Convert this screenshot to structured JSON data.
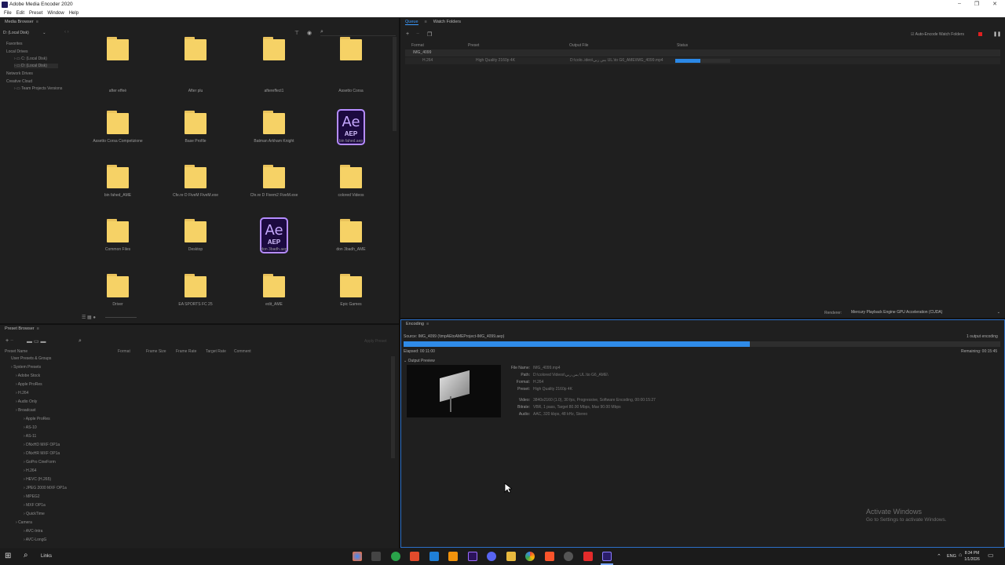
{
  "app": {
    "title": "Adobe Media Encoder 2020",
    "min": "–",
    "max": "❐",
    "close": "✕"
  },
  "menu": [
    "File",
    "Edit",
    "Preset",
    "Window",
    "Help"
  ],
  "media_browser": {
    "title": "Media Browser",
    "drive": "D: (Local Disk)",
    "tree": [
      "Favorites",
      "Local Drives",
      "C: (Local Disk)",
      "D: (Local Disk)",
      "Network Drives",
      "Creative Cloud",
      "Team Projects Versions"
    ],
    "items": [
      {
        "label": "after effeè",
        "type": "folder"
      },
      {
        "label": "After plu",
        "type": "folder"
      },
      {
        "label": "aftereffect1",
        "type": "folder"
      },
      {
        "label": "Assetto Corsa",
        "type": "folder"
      },
      {
        "label": "Assetto Corsa Competizione",
        "type": "folder"
      },
      {
        "label": "Base Profile",
        "type": "folder"
      },
      {
        "label": "Batman  Arkham Knight",
        "type": "folder"
      },
      {
        "label": "bin fahed.aep",
        "type": "aep"
      },
      {
        "label": "bin fahed_AME",
        "type": "folder"
      },
      {
        "label": "Cfe.re  D  FiveM FiveM.exe",
        "type": "folder"
      },
      {
        "label": "Cfe.re  D  Fivem2 FiveM.exe",
        "type": "folder"
      },
      {
        "label": "colored Videos",
        "type": "folder"
      },
      {
        "label": "Common Files",
        "type": "folder"
      },
      {
        "label": "Desktop",
        "type": "folder"
      },
      {
        "label": "don 3badh.aep",
        "type": "aep"
      },
      {
        "label": "don 3badh_AME",
        "type": "folder"
      },
      {
        "label": "Driver",
        "type": "folder"
      },
      {
        "label": "EA SPORTS FC 25",
        "type": "folder"
      },
      {
        "label": "edit_AME",
        "type": "folder"
      },
      {
        "label": "Epic Games",
        "type": "folder"
      }
    ],
    "aep_big": "Ae",
    "aep_small": "AEP"
  },
  "queue": {
    "tabs": [
      "Queue",
      "Watch Folders"
    ],
    "columns": {
      "format": "Format",
      "preset": "Preset",
      "output": "Output File",
      "status": "Status"
    },
    "auto_encode": "Auto-Encode Watch Folders",
    "row": {
      "name": "IMG_4099",
      "format": "H.264",
      "preset": "High Quality 2160p 4K",
      "output": "D:\\colo..ideo\\بس ربي UL.\\to G6_AME\\IMG_4099.mp4",
      "progress": 0.45
    },
    "renderer_label": "Renderer:",
    "renderer": "Mercury Playback Engine GPU Acceleration (CUDA)"
  },
  "encoding": {
    "title": "Encoding",
    "source": "Source: IMG_4099 (\\tmpAEtoAMEProject-IMG_4099.aep)",
    "outputs": "1 output encoding",
    "elapsed": "Elapsed: 00:11:00",
    "remaining": "Remaining: 00:15:45",
    "progress": 0.58,
    "output_preview": "Output Preview",
    "details": [
      {
        "k": "File Name:",
        "v": "IMG_4099.mp4"
      },
      {
        "k": "Path:",
        "v": "D:\\colored Videos\\بس ربي UL.\\to G6_AME\\"
      },
      {
        "k": "Format:",
        "v": "H.264"
      },
      {
        "k": "Preset:",
        "v": "High Quality 2160p 4K"
      },
      {
        "k": "Video:",
        "v": "3840x2160 (1.0), 30 fps, Progressive, Software Encoding, 00:00:15:27"
      },
      {
        "k": "Bitrate:",
        "v": "VBR, 1 pass, Target 80.00 Mbps, Max 90.00 Mbps"
      },
      {
        "k": "Audio:",
        "v": "AAC, 320 kbps, 48 kHz, Stereo"
      }
    ]
  },
  "preset_browser": {
    "title": "Preset Browser",
    "apply": "Apply Preset",
    "columns": [
      "Preset Name",
      "Format",
      "Frame Size",
      "Frame Rate",
      "Target Rate",
      "Comment"
    ],
    "tree": [
      "User Presets & Groups",
      "System Presets",
      "Adobe Stock",
      "Apple ProRes",
      "H.264",
      "Audio Only",
      "Broadcast",
      "Apple ProRes",
      "AS-10",
      "AS-11",
      "DNxHD MXF OP1a",
      "DNxHR MXF OP1a",
      "GoPro CineForm",
      "H.264",
      "HEVC (H.265)",
      "JPEG 2000 MXF OP1a",
      "MPEG2",
      "MXF OP1a",
      "QuickTime",
      "Camera",
      "AVC-Intra",
      "AVC-LongG"
    ]
  },
  "watermark": {
    "line1": "Activate Windows",
    "line2": "Go to Settings to activate Windows."
  },
  "taskbar": {
    "search": "Links",
    "lang": "ENG",
    "time": "8:34 PM",
    "date": "1/1/2026"
  }
}
